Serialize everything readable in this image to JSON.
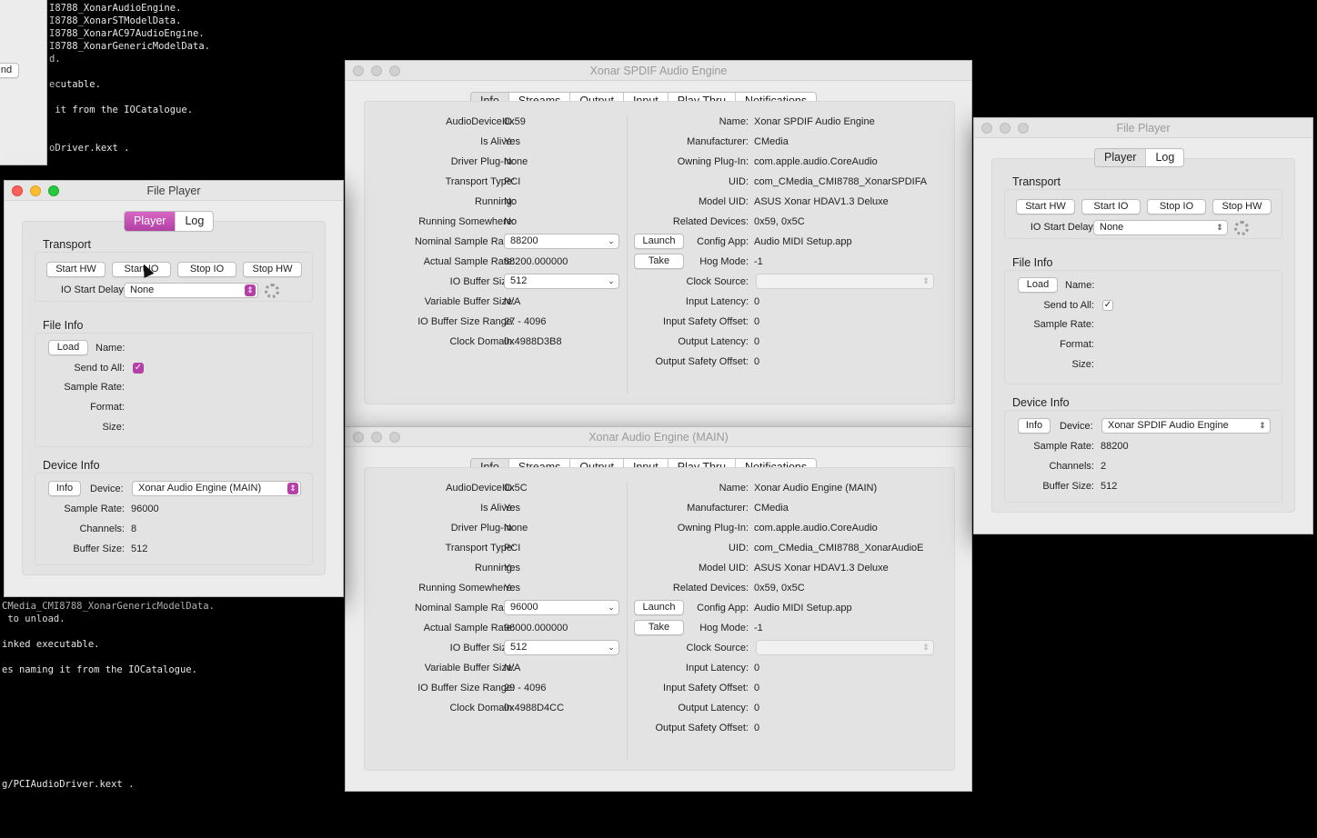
{
  "terminal": {
    "lines": [
      "I8788_XonarAudioEngine.",
      "I8788_XonarSTModelData.",
      "I8788_XonarAC97AudioEngine.",
      "I8788_XonarGenericModelData.",
      "d.",
      "ecutable.",
      " it from the IOCatalogue.",
      "oDriver.kext .",
      "CMedia_CMI8788_XonarGenericModelData.",
      " to unload.",
      "inked executable.",
      "es naming it from the IOCatalogue.",
      "g/PCIAudioDriver.kext ."
    ],
    "cut_button_label": "nd"
  },
  "spdif_window": {
    "title": "Xonar SPDIF Audio Engine",
    "tabs": [
      "Info",
      "Streams",
      "Output",
      "Input",
      "Play Thru",
      "Notifications"
    ],
    "left": {
      "labels": [
        "AudioDeviceID:",
        "Is Alive:",
        "Driver Plug-In:",
        "Transport Type:",
        "Running:",
        "Running Somewhere:",
        "Nominal Sample Rate:",
        "Actual Sample Rate:",
        "IO Buffer Size:",
        "Variable Buffer Size:",
        "IO Buffer Size Range:",
        "Clock Domain:"
      ],
      "audio_device_id": "0x59",
      "is_alive": "Yes",
      "driver_plugin": "None",
      "transport_type": "PCI",
      "running": "No",
      "running_somewhere": "No",
      "nominal_sample_rate": "88200",
      "actual_sample_rate": "88200.000000",
      "io_buffer_size": "512",
      "variable_buffer_size": "N/A",
      "io_buffer_size_range": "27 - 4096",
      "clock_domain": "0x4988D3B8"
    },
    "right": {
      "labels": [
        "Name:",
        "Manufacturer:",
        "Owning Plug-In:",
        "UID:",
        "Model UID:",
        "Related Devices:",
        "Config App:",
        "Hog Mode:",
        "Clock Source:",
        "Input Latency:",
        "Input Safety Offset:",
        "Output Latency:",
        "Output Safety Offset:"
      ],
      "name": "Xonar SPDIF Audio Engine",
      "manufacturer": "CMedia",
      "owning_plugin": "com.apple.audio.CoreAudio",
      "uid": "com_CMedia_CMI8788_XonarSPDIFA",
      "model_uid": "ASUS Xonar HDAV1.3 Deluxe",
      "related_devices": "0x59, 0x5C",
      "config_app": "Audio MIDI Setup.app",
      "hog_mode": "-1",
      "input_latency": "0",
      "input_safety_offset": "0",
      "output_latency": "0",
      "output_safety_offset": "0",
      "launch_label": "Launch",
      "take_label": "Take"
    }
  },
  "main_window": {
    "title": "Xonar Audio Engine (MAIN)",
    "tabs": [
      "Info",
      "Streams",
      "Output",
      "Input",
      "Play Thru",
      "Notifications"
    ],
    "left": {
      "labels": [
        "AudioDeviceID:",
        "Is Alive:",
        "Driver Plug-In:",
        "Transport Type:",
        "Running:",
        "Running Somewhere:",
        "Nominal Sample Rate:",
        "Actual Sample Rate:",
        "IO Buffer Size:",
        "Variable Buffer Size:",
        "IO Buffer Size Range:",
        "Clock Domain:"
      ],
      "audio_device_id": "0x5C",
      "is_alive": "Yes",
      "driver_plugin": "None",
      "transport_type": "PCI",
      "running": "Yes",
      "running_somewhere": "Yes",
      "nominal_sample_rate": "96000",
      "actual_sample_rate": "96000.000000",
      "io_buffer_size": "512",
      "variable_buffer_size": "N/A",
      "io_buffer_size_range": "29 - 4096",
      "clock_domain": "0x4988D4CC"
    },
    "right": {
      "labels": [
        "Name:",
        "Manufacturer:",
        "Owning Plug-In:",
        "UID:",
        "Model UID:",
        "Related Devices:",
        "Config App:",
        "Hog Mode:",
        "Clock Source:",
        "Input Latency:",
        "Input Safety Offset:",
        "Output Latency:",
        "Output Safety Offset:"
      ],
      "name": "Xonar Audio Engine (MAIN)",
      "manufacturer": "CMedia",
      "owning_plugin": "com.apple.audio.CoreAudio",
      "uid": "com_CMedia_CMI8788_XonarAudioE",
      "model_uid": "ASUS Xonar HDAV1.3 Deluxe",
      "related_devices": "0x59, 0x5C",
      "config_app": "Audio MIDI Setup.app",
      "hog_mode": "-1",
      "input_latency": "0",
      "input_safety_offset": "0",
      "output_latency": "0",
      "output_safety_offset": "0",
      "launch_label": "Launch",
      "take_label": "Take"
    }
  },
  "player_left": {
    "title": "File Player",
    "tabs": [
      "Player",
      "Log"
    ],
    "transport_title": "Transport",
    "buttons": [
      "Start HW",
      "Start IO",
      "Stop IO",
      "Stop HW"
    ],
    "io_start_delay_label": "IO Start Delay:",
    "io_start_delay_value": "None",
    "file_info_title": "File Info",
    "load_label": "Load",
    "name_label": "Name:",
    "send_to_all_label": "Send to All:",
    "send_to_all_checked": true,
    "sample_rate_label": "Sample Rate:",
    "format_label": "Format:",
    "size_label": "Size:",
    "device_info_title": "Device Info",
    "info_label": "Info",
    "device_label": "Device:",
    "device_value": "Xonar Audio Engine (MAIN)",
    "device_sample_rate_label": "Sample Rate:",
    "device_sample_rate": "96000",
    "channels_label": "Channels:",
    "channels": "8",
    "buffer_size_label": "Buffer Size:",
    "buffer_size": "512",
    "accent_color": "#b53fa8"
  },
  "player_right": {
    "title": "File Player",
    "tabs": [
      "Player",
      "Log"
    ],
    "transport_title": "Transport",
    "buttons": [
      "Start HW",
      "Start IO",
      "Stop IO",
      "Stop HW"
    ],
    "io_start_delay_label": "IO Start Delay:",
    "io_start_delay_value": "None",
    "file_info_title": "File Info",
    "load_label": "Load",
    "name_label": "Name:",
    "send_to_all_label": "Send to All:",
    "send_to_all_checked": true,
    "sample_rate_label": "Sample Rate:",
    "format_label": "Format:",
    "size_label": "Size:",
    "device_info_title": "Device Info",
    "info_label": "Info",
    "device_label": "Device:",
    "device_value": "Xonar SPDIF Audio Engine",
    "device_sample_rate_label": "Sample Rate:",
    "device_sample_rate": "88200",
    "channels_label": "Channels:",
    "channels": "2",
    "buffer_size_label": "Buffer Size:",
    "buffer_size": "512"
  }
}
